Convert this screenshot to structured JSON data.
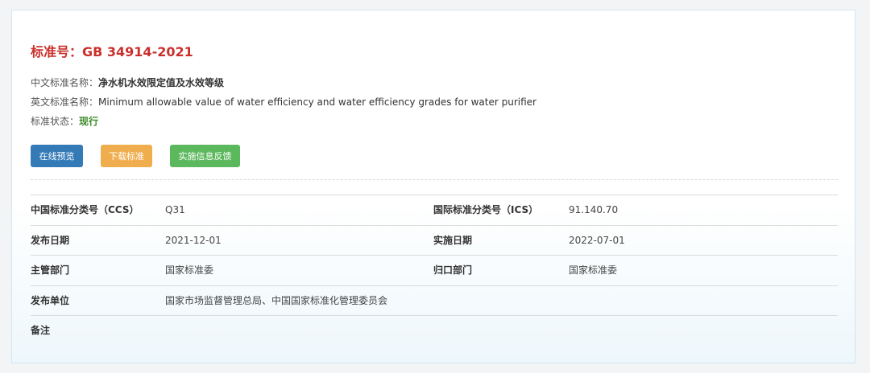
{
  "header": {
    "title": "标准号：GB 34914-2021"
  },
  "meta": {
    "cn_name_label": "中文标准名称：",
    "cn_name_value": "净水机水效限定值及水效等级",
    "en_name_label": "英文标准名称：",
    "en_name_value": "Minimum allowable value of water efficiency and water efficiency grades for water purifier",
    "status_label": "标准状态：",
    "status_value": "现行"
  },
  "buttons": {
    "preview": "在线预览",
    "download": "下载标准",
    "feedback": "实施信息反馈"
  },
  "colors": {
    "title": "#c9302c",
    "status": "#3c8a28",
    "preview_btn": "#337ab7",
    "download_btn": "#f0ad4e",
    "feedback_btn": "#5cb85c"
  },
  "table": {
    "ccs_label": "中国标准分类号（CCS）",
    "ccs_value": "Q31",
    "ics_label": "国际标准分类号（ICS）",
    "ics_value": "91.140.70",
    "publish_date_label": "发布日期",
    "publish_date_value": "2021-12-01",
    "impl_date_label": "实施日期",
    "impl_date_value": "2022-07-01",
    "dept_label": "主管部门",
    "dept_value": "国家标准委",
    "central_dept_label": "归口部门",
    "central_dept_value": "国家标准委",
    "publisher_label": "发布单位",
    "publisher_value": "国家市场监督管理总局、中国国家标准化管理委员会",
    "remark_label": "备注",
    "remark_value": ""
  }
}
